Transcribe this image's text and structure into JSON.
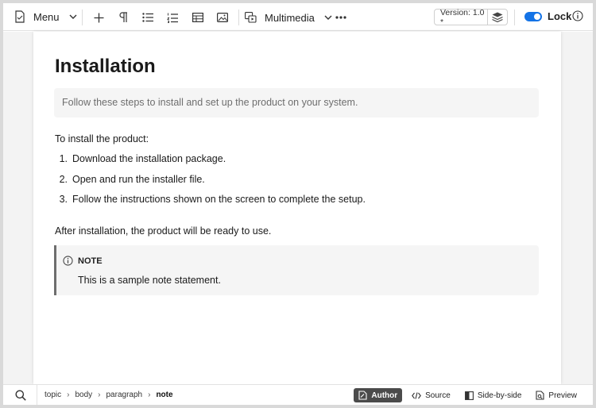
{
  "toolbar": {
    "menu_label": "Menu",
    "multimedia_label": "Multimedia",
    "version_label": "Version: 1.0 *",
    "lock_label": "Lock"
  },
  "document": {
    "title": "Installation",
    "shortdesc": "Follow these steps to install and set up the product on your system.",
    "intro": "To install the product:",
    "steps": [
      {
        "num": "1.",
        "text": "Download the installation package."
      },
      {
        "num": "2.",
        "text": "Open and run the installer file."
      },
      {
        "num": "3.",
        "text": "Follow the instructions shown on the screen to complete the setup."
      }
    ],
    "after": "After installation, the product will be ready to use.",
    "note": {
      "label": "NOTE",
      "text": "This is a sample note statement."
    }
  },
  "statusbar": {
    "breadcrumbs": [
      "topic",
      "body",
      "paragraph",
      "note"
    ],
    "modes": [
      "Author",
      "Source",
      "Side-by-side",
      "Preview"
    ],
    "active_mode": "Author"
  },
  "colors": {
    "accent": "#1473e6",
    "active_mode_bg": "#4b4b4b"
  }
}
